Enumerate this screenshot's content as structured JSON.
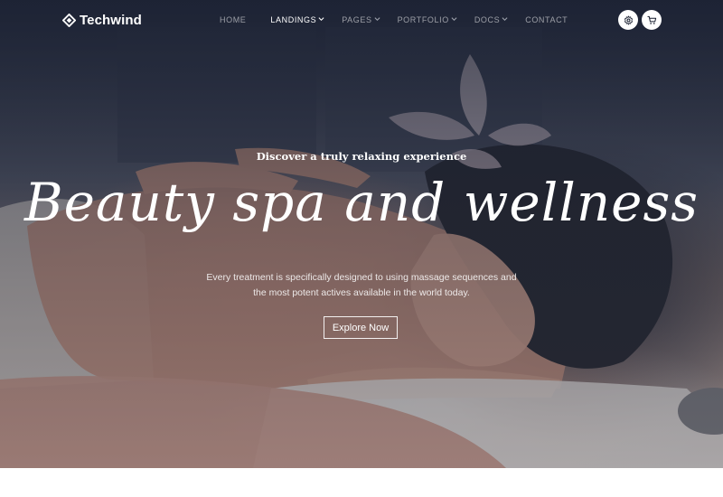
{
  "brand": {
    "name": "Techwind",
    "logo_icon": "techwind-logo-icon"
  },
  "nav": {
    "items": [
      {
        "label": "HOME",
        "has_dropdown": false,
        "active": false
      },
      {
        "label": "LANDINGS",
        "has_dropdown": true,
        "active": true
      },
      {
        "label": "PAGES",
        "has_dropdown": true,
        "active": false
      },
      {
        "label": "PORTFOLIO",
        "has_dropdown": true,
        "active": false
      },
      {
        "label": "DOCS",
        "has_dropdown": true,
        "active": false
      },
      {
        "label": "CONTACT",
        "has_dropdown": false,
        "active": false
      }
    ],
    "actions": [
      {
        "icon": "gear-icon"
      },
      {
        "icon": "shopping-cart-icon"
      }
    ]
  },
  "hero": {
    "tagline": "Discover a truly relaxing experience",
    "headline": "Beauty spa and wellness",
    "description_line1": "Every treatment is specifically designed to using massage sequences and",
    "description_line2": "the most potent actives available in the world today.",
    "cta_label": "Explore Now"
  },
  "colors": {
    "overlay": "#161c2d",
    "text": "#ffffff",
    "nav_muted": "#a0a4ae"
  }
}
